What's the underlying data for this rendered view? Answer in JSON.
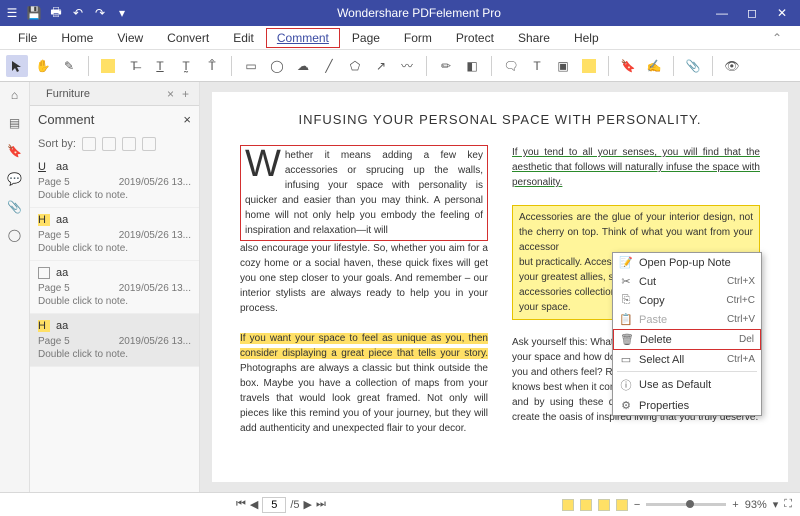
{
  "app_title": "Wondershare PDFelement Pro",
  "menu": [
    "File",
    "Home",
    "View",
    "Convert",
    "Edit",
    "Comment",
    "Page",
    "Form",
    "Protect",
    "Share",
    "Help"
  ],
  "menu_active": "Comment",
  "tab": {
    "name": "Furniture"
  },
  "panel": {
    "title": "Comment",
    "sort_label": "Sort by:"
  },
  "comments": [
    {
      "icon": "underline",
      "author": "aa",
      "page": "Page 5",
      "date": "2019/05/26 13...",
      "note": "Double click to note."
    },
    {
      "icon": "highlight",
      "author": "aa",
      "page": "Page 5",
      "date": "2019/05/26 13...",
      "note": "Double click to note."
    },
    {
      "icon": "box",
      "author": "aa",
      "page": "Page 5",
      "date": "2019/05/26 13...",
      "note": "Double click to note."
    },
    {
      "icon": "highlight",
      "author": "aa",
      "page": "Page 5",
      "date": "2019/05/26 13...",
      "note": "Double click to note."
    }
  ],
  "doc": {
    "heading": "INFUSING YOUR PERSONAL SPACE WITH PERSONALITY.",
    "para1a": "hether it means adding a few key accessories or sprucing up the walls, infusing your space with personality is quicker and easier than you may think. A personal home will not only help you embody the feeling of inspiration and relaxation—it will",
    "para1b": "also encourage your lifestyle. So, whether you aim for a cozy home or a social haven, these quick fixes will get you one step closer to your goals. And remember – our interior stylists are always ready to help you in your process.",
    "para2a": "If you want your space to feel as unique as you, then consider displaying a great piece that tells your story.",
    "para2b": " Photographs are always a classic but think outside the box. Maybe you have a collection of maps from your travels that would look great framed. Not only will pieces like this remind you of your journey, but they will add authenticity and unexpected flair to your decor.",
    "right1": "If you tend to all your senses, you will find that the aesthetic that follows will naturally infuse the space with personality.",
    "right2a": "Accessories are the glue of your interior design, not the cherry on top. Think of what you want from your accessor",
    "right2b": "but practically. Accessor",
    "right2c": "your greatest allies, so b",
    "right2d": "accessories collection to",
    "right2e": "your space.",
    "right3a": "Ask yourself this: What",
    "right3b": "your space and how do yo",
    "right3c": "you and others feel? Ren",
    "right3d": "knows best when it com",
    "right3e": "and by using these quick fixes as a guide, you can create the oasis of inspired living that you truly deserve."
  },
  "context_menu": [
    {
      "label": "Open Pop-up Note",
      "shortcut": "",
      "icon": "📝"
    },
    {
      "label": "Cut",
      "shortcut": "Ctrl+X",
      "icon": "✂"
    },
    {
      "label": "Copy",
      "shortcut": "Ctrl+C",
      "icon": "⎘"
    },
    {
      "label": "Paste",
      "shortcut": "Ctrl+V",
      "icon": "📋",
      "disabled": true
    },
    {
      "label": "Delete",
      "shortcut": "Del",
      "icon": "🗑",
      "selected": true
    },
    {
      "label": "Select All",
      "shortcut": "Ctrl+A",
      "icon": "▭"
    },
    {
      "label": "Use as Default",
      "shortcut": "",
      "icon": "ⓘ"
    },
    {
      "label": "Properties",
      "shortcut": "",
      "icon": "⚙"
    }
  ],
  "status": {
    "current_page": "5",
    "total_pages": "/5",
    "zoom": "93%"
  }
}
